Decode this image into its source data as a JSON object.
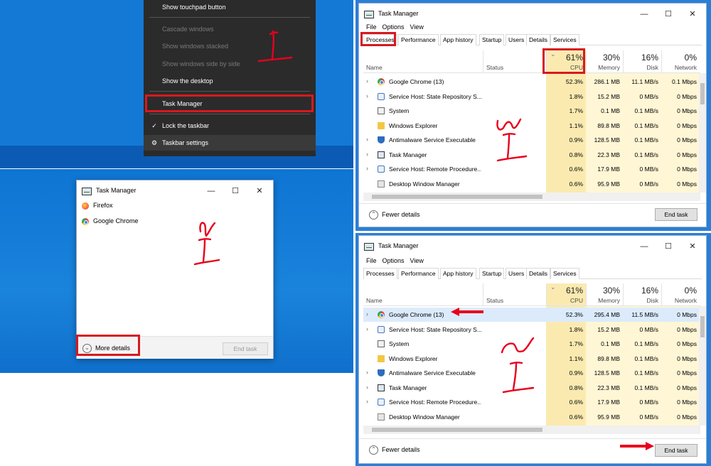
{
  "context_menu": {
    "items": [
      {
        "label": "Show touchpad button",
        "disabled": false
      },
      {
        "label": "Cascade windows",
        "disabled": true
      },
      {
        "label": "Show windows stacked",
        "disabled": true
      },
      {
        "label": "Show windows side by side",
        "disabled": true
      },
      {
        "label": "Show the desktop",
        "disabled": false
      },
      {
        "label": "Task Manager",
        "disabled": false
      },
      {
        "label": "Lock the taskbar",
        "disabled": false,
        "glyph": "✓"
      },
      {
        "label": "Taskbar settings",
        "disabled": false,
        "glyph": "⚙"
      }
    ]
  },
  "compact_tm": {
    "title": "Task Manager",
    "apps": [
      "Firefox",
      "Google Chrome"
    ],
    "more_details": "More details",
    "end_task": "End task"
  },
  "full_tm": {
    "title": "Task Manager",
    "menu": [
      "File",
      "Options",
      "View"
    ],
    "tabs": [
      "Processes",
      "Performance",
      "App history",
      "Startup",
      "Users",
      "Details",
      "Services"
    ],
    "columns": {
      "name": "Name",
      "status": "Status",
      "cpu_pct": "61%",
      "cpu": "CPU",
      "mem_pct": "30%",
      "mem": "Memory",
      "disk_pct": "16%",
      "disk": "Disk",
      "net_pct": "0%",
      "net": "Network"
    },
    "fewer_details": "Fewer details",
    "end_task": "End task",
    "processes_top": [
      {
        "name": "Google Chrome (13)",
        "icon": "chrome-icon",
        "expand": true,
        "cpu": "52.3%",
        "mem": "286.1 MB",
        "disk": "11.1 MB/s",
        "net": "0.1 Mbps"
      },
      {
        "name": "Service Host: State Repository S...",
        "icon": "gear-icon",
        "expand": true,
        "cpu": "1.8%",
        "mem": "15.2 MB",
        "disk": "0 MB/s",
        "net": "0 Mbps"
      },
      {
        "name": "System",
        "icon": "system-icon",
        "expand": false,
        "cpu": "1.7%",
        "mem": "0.1 MB",
        "disk": "0.1 MB/s",
        "net": "0 Mbps"
      },
      {
        "name": "Windows Explorer",
        "icon": "folder-icon",
        "expand": false,
        "cpu": "1.1%",
        "mem": "89.8 MB",
        "disk": "0.1 MB/s",
        "net": "0 Mbps"
      },
      {
        "name": "Antimalware Service Executable",
        "icon": "shield-icon",
        "expand": true,
        "cpu": "0.9%",
        "mem": "128.5 MB",
        "disk": "0.1 MB/s",
        "net": "0 Mbps"
      },
      {
        "name": "Task Manager",
        "icon": "taskmanager-icon",
        "expand": true,
        "cpu": "0.8%",
        "mem": "22.3 MB",
        "disk": "0.1 MB/s",
        "net": "0 Mbps"
      },
      {
        "name": "Service Host: Remote Procedure...",
        "icon": "gear-icon",
        "expand": true,
        "cpu": "0.6%",
        "mem": "17.9 MB",
        "disk": "0 MB/s",
        "net": "0 Mbps"
      },
      {
        "name": "Desktop Window Manager",
        "icon": "dwm-icon",
        "expand": false,
        "cpu": "0.6%",
        "mem": "95.9 MB",
        "disk": "0 MB/s",
        "net": "0 Mbps"
      }
    ],
    "processes_bottom": [
      {
        "name": "Google Chrome (13)",
        "icon": "chrome-icon",
        "expand": true,
        "cpu": "52.3%",
        "mem": "295.4 MB",
        "disk": "11.5 MB/s",
        "net": "0 Mbps"
      },
      {
        "name": "Service Host: State Repository S...",
        "icon": "gear-icon",
        "expand": true,
        "cpu": "1.8%",
        "mem": "15.2 MB",
        "disk": "0 MB/s",
        "net": "0 Mbps"
      },
      {
        "name": "System",
        "icon": "system-icon",
        "expand": false,
        "cpu": "1.7%",
        "mem": "0.1 MB",
        "disk": "0.1 MB/s",
        "net": "0 Mbps"
      },
      {
        "name": "Windows Explorer",
        "icon": "folder-icon",
        "expand": false,
        "cpu": "1.1%",
        "mem": "89.8 MB",
        "disk": "0.1 MB/s",
        "net": "0 Mbps"
      },
      {
        "name": "Antimalware Service Executable",
        "icon": "shield-icon",
        "expand": true,
        "cpu": "0.9%",
        "mem": "128.5 MB",
        "disk": "0.1 MB/s",
        "net": "0 Mbps"
      },
      {
        "name": "Task Manager",
        "icon": "taskmanager-icon",
        "expand": true,
        "cpu": "0.8%",
        "mem": "22.3 MB",
        "disk": "0.1 MB/s",
        "net": "0 Mbps"
      },
      {
        "name": "Service Host: Remote Procedure...",
        "icon": "gear-icon",
        "expand": true,
        "cpu": "0.6%",
        "mem": "17.9 MB",
        "disk": "0 MB/s",
        "net": "0 Mbps"
      },
      {
        "name": "Desktop Window Manager",
        "icon": "dwm-icon",
        "expand": false,
        "cpu": "0.6%",
        "mem": "95.9 MB",
        "disk": "0 MB/s",
        "net": "0 Mbps"
      }
    ]
  },
  "colors": {
    "highlight": "#d71920",
    "cpu_col": "#fbeab0",
    "cell_col": "#fff6d5",
    "selected_row": "#dcebfb"
  }
}
